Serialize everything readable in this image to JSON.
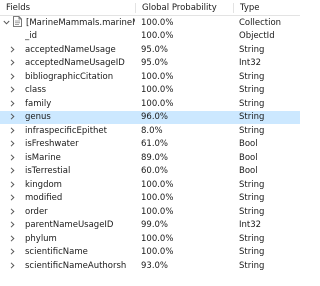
{
  "header": {
    "fields": "Fields",
    "probability": "Global Probability",
    "type": "Type"
  },
  "root": {
    "name": "[MarineMammals.marineM",
    "probability": "100.0%",
    "type": "Collection",
    "icon": "document-icon",
    "expander": "chevron-down-icon"
  },
  "rows": [
    {
      "name": "_id",
      "probability": "100.0%",
      "type": "ObjectId",
      "expandable": false
    },
    {
      "name": "acceptedNameUsage",
      "probability": "95.0%",
      "type": "String",
      "expandable": true
    },
    {
      "name": "acceptedNameUsageID",
      "probability": "95.0%",
      "type": "Int32",
      "expandable": true
    },
    {
      "name": "bibliographicCitation",
      "probability": "100.0%",
      "type": "String",
      "expandable": true
    },
    {
      "name": "class",
      "probability": "100.0%",
      "type": "String",
      "expandable": true
    },
    {
      "name": "family",
      "probability": "100.0%",
      "type": "String",
      "expandable": true
    },
    {
      "name": "genus",
      "probability": "96.0%",
      "type": "String",
      "expandable": true,
      "selected": true
    },
    {
      "name": "infraspecificEpithet",
      "probability": "8.0%",
      "type": "String",
      "expandable": true
    },
    {
      "name": "isFreshwater",
      "probability": "61.0%",
      "type": "Bool",
      "expandable": true
    },
    {
      "name": "isMarine",
      "probability": "89.0%",
      "type": "Bool",
      "expandable": true
    },
    {
      "name": "isTerrestial",
      "probability": "60.0%",
      "type": "Bool",
      "expandable": true
    },
    {
      "name": "kingdom",
      "probability": "100.0%",
      "type": "String",
      "expandable": true
    },
    {
      "name": "modified",
      "probability": "100.0%",
      "type": "String",
      "expandable": true
    },
    {
      "name": "order",
      "probability": "100.0%",
      "type": "String",
      "expandable": true
    },
    {
      "name": "parentNameUsageID",
      "probability": "99.0%",
      "type": "Int32",
      "expandable": true
    },
    {
      "name": "phylum",
      "probability": "100.0%",
      "type": "String",
      "expandable": true
    },
    {
      "name": "scientificName",
      "probability": "100.0%",
      "type": "String",
      "expandable": true
    },
    {
      "name": "scientificNameAuthorsh",
      "probability": "93.0%",
      "type": "String",
      "expandable": true
    }
  ],
  "colors": {
    "selected_row": "#cce8ff",
    "text": "#1a1a1a",
    "chevron": "#555555"
  }
}
